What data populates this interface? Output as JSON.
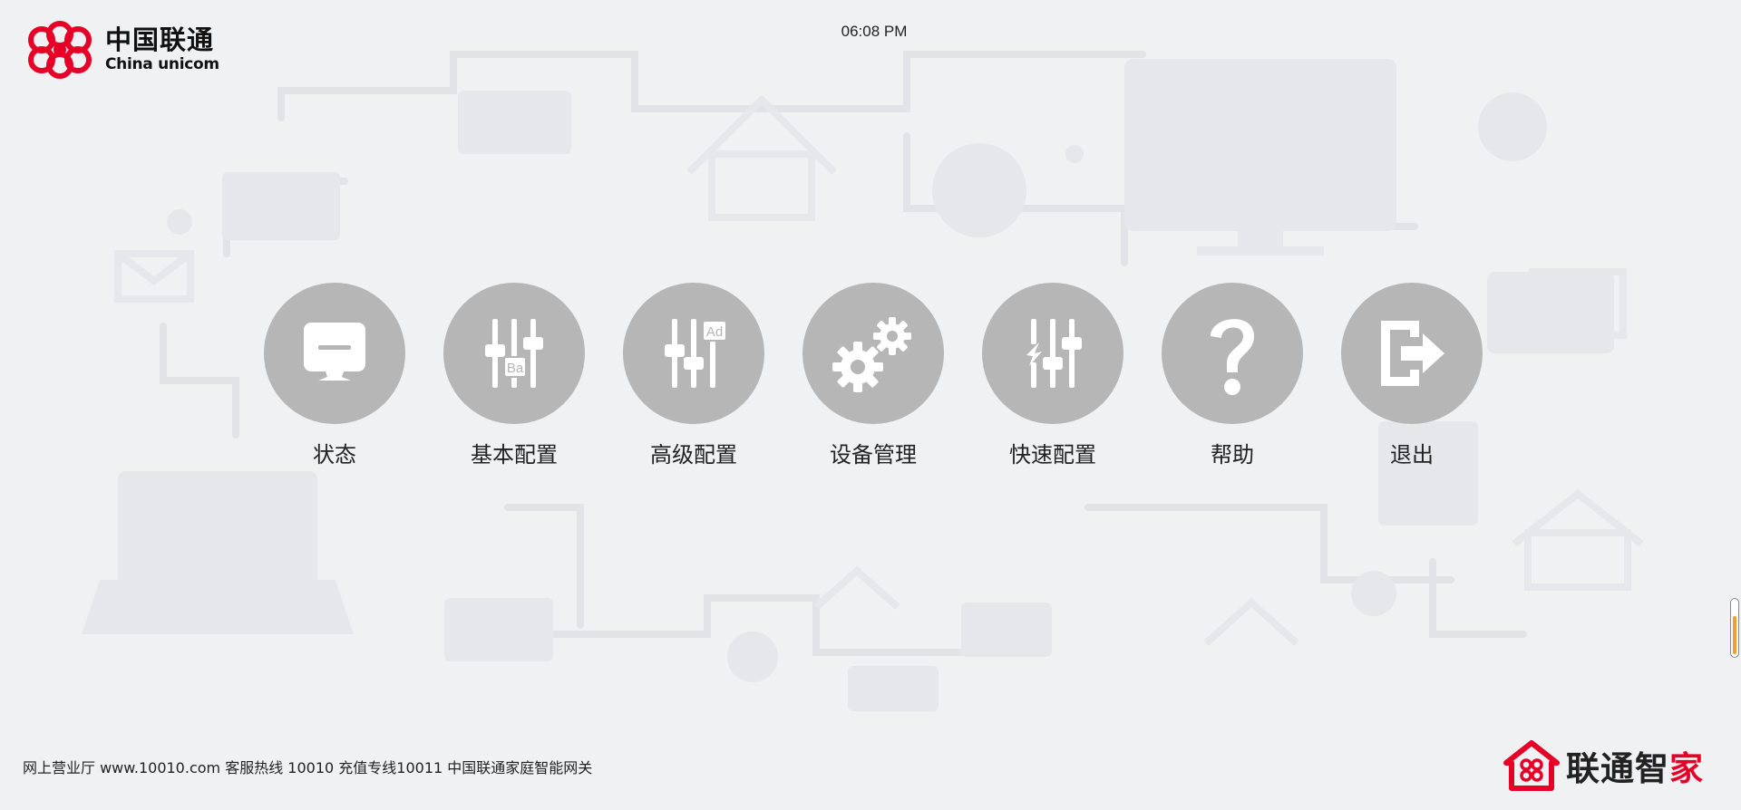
{
  "header": {
    "logo_cn": "中国联通",
    "logo_en": "China unicom",
    "time": "06:08 PM"
  },
  "menu": {
    "items": [
      {
        "label": "状态",
        "icon": "monitor-icon"
      },
      {
        "label": "基本配置",
        "icon": "sliders-basic-icon",
        "badge": "Ba"
      },
      {
        "label": "高级配置",
        "icon": "sliders-advanced-icon",
        "badge": "Ad"
      },
      {
        "label": "设备管理",
        "icon": "gears-icon"
      },
      {
        "label": "快速配置",
        "icon": "sliders-quick-icon"
      },
      {
        "label": "帮助",
        "icon": "question-icon"
      },
      {
        "label": "退出",
        "icon": "exit-icon"
      }
    ]
  },
  "footer": {
    "text": "网上营业厅 www.10010.com 客服热线 10010 充值专线10011 中国联通家庭智能网关"
  },
  "brand": {
    "text_main": "联通智",
    "text_accent": "家"
  },
  "colors": {
    "circle": "#b6b6b6",
    "background": "#f0f1f3",
    "brand_red": "#e60027",
    "scroll_accent": "#f0a030"
  }
}
